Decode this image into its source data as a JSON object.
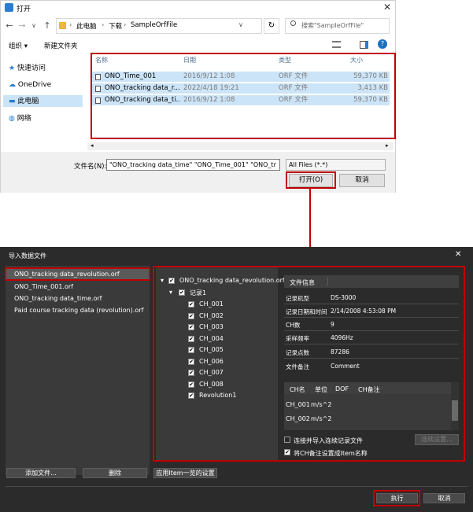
{
  "open_dialog": {
    "title": "打开",
    "close_glyph": "✕",
    "nav": {
      "back": "←",
      "forward": "→",
      "dropdown": "∨",
      "up": "↑"
    },
    "breadcrumb": [
      "此电脑",
      "下载",
      "SampleOrfFile"
    ],
    "breadcrumb_sep": "›",
    "refresh_glyph": "↻",
    "search_placeholder": "搜索\"SampleOrfFile\"",
    "toolbar": {
      "organize": "组织 ▾",
      "new_folder": "新建文件夹",
      "help": "?"
    },
    "sidebar": [
      {
        "label": "快速访问",
        "icon": "star-icon"
      },
      {
        "label": "OneDrive",
        "icon": "cloud-icon"
      },
      {
        "label": "此电脑",
        "icon": "computer-icon",
        "selected": true
      },
      {
        "label": "网络",
        "icon": "network-icon"
      }
    ],
    "columns": [
      "名称",
      "日期",
      "类型",
      "大小"
    ],
    "files": [
      {
        "name": "ONO_Time_001",
        "date": "2016/9/12 1:08",
        "type": "ORF 文件",
        "size": "59,370 KB"
      },
      {
        "name": "ONO_tracking data_r...",
        "date": "2022/4/18 19:21",
        "type": "ORF 文件",
        "size": "3,413 KB"
      },
      {
        "name": "ONO_tracking data_ti...",
        "date": "2016/9/12 1:08",
        "type": "ORF 文件",
        "size": "59,370 KB"
      }
    ],
    "filename_label": "文件名(N):",
    "filename_value": "\"ONO_tracking data_time\" \"ONO_Time_001\" \"ONO_tr",
    "filter_value": "All Files (*.*)",
    "open_button": "打开(O)",
    "cancel_button": "取消"
  },
  "import_dialog": {
    "title": "导入数据文件",
    "close_glyph": "✕",
    "files": [
      "ONO_tracking data_revolution.orf",
      "ONO_Time_001.orf",
      "ONO_tracking data_time.orf",
      "Paid course tracking data (revolution).orf"
    ],
    "tree": {
      "root": "ONO_tracking data_revolution.orf",
      "record": "记录1",
      "channels": [
        "CH_001",
        "CH_002",
        "CH_003",
        "CH_004",
        "CH_005",
        "CH_006",
        "CH_007",
        "CH_008",
        "Revolution1"
      ]
    },
    "info_header": "文件信息",
    "info": [
      {
        "label": "记录机型",
        "value": "DS-3000"
      },
      {
        "label": "记录日期和时间",
        "value": "2/14/2008 4:53:08 PM"
      },
      {
        "label": "CH数",
        "value": "9"
      },
      {
        "label": "采样频率",
        "value": "4096Hz"
      },
      {
        "label": "记录点数",
        "value": "87286"
      },
      {
        "label": "文件备注",
        "value": "Comment"
      }
    ],
    "ch_columns": [
      "CH名",
      "单位",
      "DOF",
      "CH备注"
    ],
    "ch_rows": [
      {
        "name": "CH_001",
        "unit": "m/s^2"
      },
      {
        "name": "CH_002",
        "unit": "m/s^2"
      }
    ],
    "opt_continuous": "连接并导入连续记录文件",
    "opt_continuous_checked": false,
    "opt_continuous_btn": "连续设置...",
    "opt_itemname": "将CH备注设置成Item名称",
    "opt_itemname_checked": true,
    "add_file_button": "添加文件...",
    "delete_button": "删除",
    "apply_button": "应用Item一览的设置",
    "execute_button": "执行",
    "cancel_button": "取消",
    "expanded_glyph": "▾",
    "check_glyph": "✔"
  },
  "colors": {
    "highlight_red": "#c00000",
    "selection_blue": "#cce4f7",
    "dark_bg": "#2b2b2b"
  }
}
